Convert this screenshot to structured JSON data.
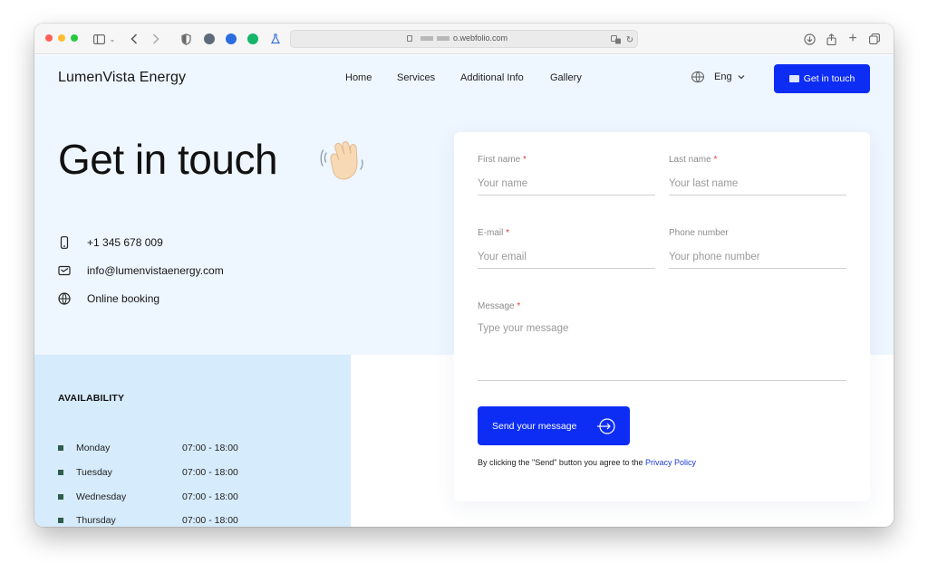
{
  "browser": {
    "url": "o.webfolio.com"
  },
  "header": {
    "brand": "LumenVista Energy",
    "nav": [
      "Home",
      "Services",
      "Additional Info",
      "Gallery"
    ],
    "language": "Eng",
    "cta_label": "Get in touch"
  },
  "hero": {
    "title": "Get in touch",
    "contacts": [
      {
        "icon": "phone-icon",
        "text": "+1 345 678 009"
      },
      {
        "icon": "mail-icon",
        "text": "info@lumenvistaenergy.com"
      },
      {
        "icon": "globe-icon",
        "text": "Online booking"
      }
    ]
  },
  "availability": {
    "title": "AVAILABILITY",
    "days": [
      {
        "day": "Monday",
        "hours": "07:00 - 18:00"
      },
      {
        "day": "Tuesday",
        "hours": "07:00 - 18:00"
      },
      {
        "day": "Wednesday",
        "hours": "07:00 - 18:00"
      },
      {
        "day": "Thursday",
        "hours": "07:00 - 18:00"
      }
    ]
  },
  "form": {
    "first_name": {
      "label": "First name",
      "required": "*",
      "placeholder": "Your name"
    },
    "last_name": {
      "label": "Last name",
      "required": "*",
      "placeholder": "Your last name"
    },
    "email": {
      "label": "E-mail",
      "required": "*",
      "placeholder": "Your email"
    },
    "phone": {
      "label": "Phone number",
      "placeholder": "Your phone number"
    },
    "message": {
      "label": "Message",
      "required": "*",
      "placeholder": "Type your message"
    },
    "send_label": "Send your message",
    "consent_text": "By clicking the \"Send\" button you agree to the",
    "privacy_link": "Privacy Policy"
  },
  "colors": {
    "accent": "#0d2df5",
    "hero_bg": "#eef6ff",
    "availability_bg": "#d6ebfb",
    "required": "#e03b3b"
  }
}
